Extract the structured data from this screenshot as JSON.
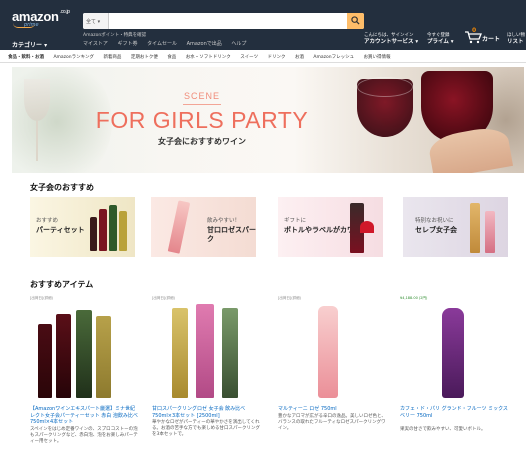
{
  "header": {
    "logo": "amazon",
    "logo_suffix": ".co.jp",
    "logo_prime": "prime",
    "search": {
      "category": "全て ▾",
      "placeholder": ""
    },
    "address": "Amazonポイント・特典を確認",
    "category_dropdown": "カテゴリー ▾",
    "nav_links": [
      "マイストア",
      "ギフト券",
      "タイムセール",
      "Amazonで出品",
      "ヘルプ"
    ],
    "account": {
      "greeting": "こんにちは、サインイン",
      "label": "アカウントサービス ▾"
    },
    "prime": {
      "line1": "今すぐ登録",
      "label": "プライム ▾"
    },
    "cart": {
      "count": "0",
      "label": "カート"
    },
    "list": {
      "line1": "ほしい物",
      "label": "リスト"
    }
  },
  "subnav": [
    "食品・飲料・お酒",
    "Amazonランキング",
    "新着商品",
    "定期おトク便",
    "食品",
    "お水・ソフトドリンク",
    "スイーツ",
    "ドリンク",
    "お酒",
    "Amazonフレッシュ",
    "お買い得情報"
  ],
  "banner": {
    "scene": "SCENE",
    "title": "FOR GIRLS PARTY",
    "subtitle": "女子会におすすめワイン"
  },
  "recommend": {
    "title": "女子会のおすすめ",
    "cards": [
      {
        "small": "おすすめ",
        "big": "パーティセット"
      },
      {
        "small": "飲みやすい！",
        "big": "甘口ロゼスパーク"
      },
      {
        "small": "ギフトに",
        "big": "ボトルやラベルがカワイイ"
      },
      {
        "small": "特別なお祝いに",
        "big": "セレブ女子会"
      }
    ]
  },
  "items": {
    "title": "おすすめアイテム",
    "list": [
      {
        "badge": "[出荷日](詳細)",
        "name": "【Amazonワインエキスパート厳選】ミナ世紀レクト女子会パーティーセット 赤白 泡飲み比べ 750ml×4本セット",
        "desc": "スペインをはじめ定番ワインの、スプロコストーの泡もスパークリングなど、赤白泡、泡をお楽しみパーティー用セット。"
      },
      {
        "badge": "[出荷日](詳細)",
        "name": "甘口スパークリングロゼ 女子会 飲み比べ 750ml×3本セット [2500ml]",
        "desc": "華やかなロゼがパーティーの華やかさを演出してくれる。お酒の苦手な方でも楽しめる甘口スパークリングを3本セットで。"
      },
      {
        "badge": "[出荷日](詳細)",
        "name": "マルティーニ ロゼ 750ml",
        "desc": "豊かなアロマが広がる辛口の逸品。美しいロゼ色と、バランスの取れたフルーティなロゼスパークリングワイン。"
      },
      {
        "badge": "¥4,188.00 (2円)",
        "name": "カフェ・ド・パリ グランド・フルーツ ミックスベリー 750ml",
        "desc": "果実の甘さで飲みやすい、可愛いボトル。"
      }
    ]
  },
  "colors": {
    "header_bg": "#232f3e",
    "search_button": "#febd69",
    "banner_title": "#ee6f5d",
    "link": "#0066c0"
  }
}
